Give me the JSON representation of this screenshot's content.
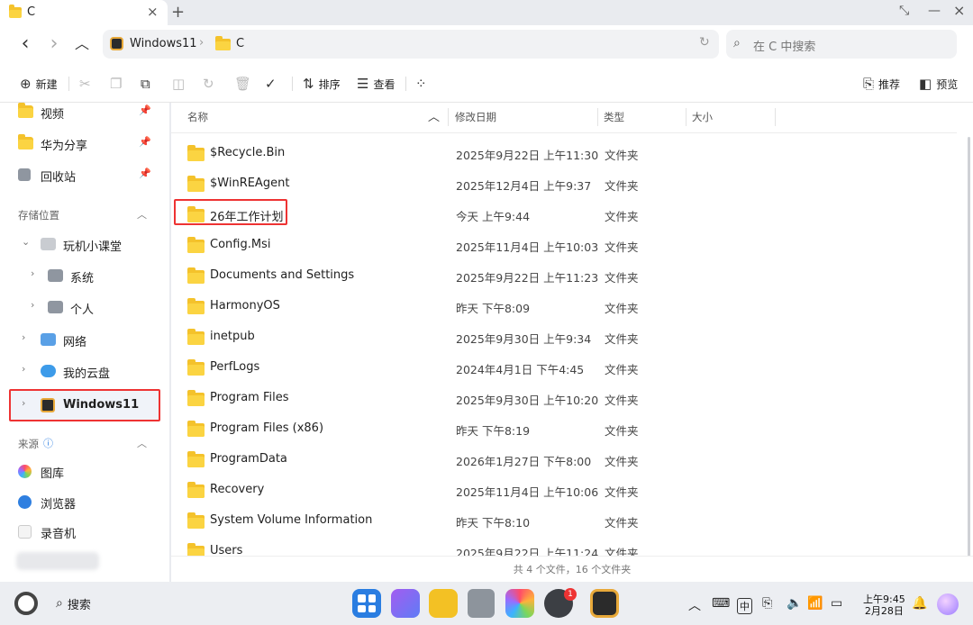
{
  "tab": {
    "title": "C",
    "close": "×",
    "new_tab": "+"
  },
  "window_controls": {
    "collapse": "⤡",
    "minimize": "—",
    "close": "×"
  },
  "nav": {
    "back": "‹",
    "forward": "›",
    "up": "︿"
  },
  "address": {
    "root": "Windows11",
    "separator": "›",
    "current": "C",
    "refresh": "↻"
  },
  "search": {
    "placeholder": "在 C 中搜索",
    "icon": "⌕"
  },
  "toolbar": {
    "new": "新建",
    "sort": "排序",
    "view": "查看",
    "recommend": "推荐",
    "preview": "预览"
  },
  "sidebar": {
    "quick": [
      {
        "label": "视频",
        "pinned": true
      },
      {
        "label": "华为分享",
        "pinned": true
      },
      {
        "label": "回收站",
        "pinned": true
      }
    ],
    "storage_header": "存储位置",
    "storage": [
      {
        "label": "玩机小课堂",
        "expanded": true
      },
      {
        "label": "系统"
      },
      {
        "label": "个人"
      },
      {
        "label": "网络"
      },
      {
        "label": "我的云盘"
      },
      {
        "label": "Windows11",
        "selected": true
      }
    ],
    "source_header": "来源",
    "sources": [
      {
        "label": "图库"
      },
      {
        "label": "浏览器"
      },
      {
        "label": "录音机"
      }
    ]
  },
  "columns": {
    "name": "名称",
    "modified": "修改日期",
    "type": "类型",
    "size": "大小"
  },
  "files": [
    {
      "name": "$Recycle.Bin",
      "modified": "2025年9月22日 上午11:30",
      "type": "文件夹"
    },
    {
      "name": "$WinREAgent",
      "modified": "2025年12月4日 上午9:37",
      "type": "文件夹"
    },
    {
      "name": "26年工作计划",
      "modified": "今天 上午9:44",
      "type": "文件夹",
      "highlighted": true
    },
    {
      "name": "Config.Msi",
      "modified": "2025年11月4日 上午10:03",
      "type": "文件夹"
    },
    {
      "name": "Documents and Settings",
      "modified": "2025年9月22日 上午11:23",
      "type": "文件夹"
    },
    {
      "name": "HarmonyOS",
      "modified": "昨天 下午8:09",
      "type": "文件夹"
    },
    {
      "name": "inetpub",
      "modified": "2025年9月30日 上午9:34",
      "type": "文件夹"
    },
    {
      "name": "PerfLogs",
      "modified": "2024年4月1日 下午4:45",
      "type": "文件夹"
    },
    {
      "name": "Program Files",
      "modified": "2025年9月30日 上午10:20",
      "type": "文件夹"
    },
    {
      "name": "Program Files (x86)",
      "modified": "昨天 下午8:19",
      "type": "文件夹"
    },
    {
      "name": "ProgramData",
      "modified": "2026年1月27日 下午8:00",
      "type": "文件夹"
    },
    {
      "name": "Recovery",
      "modified": "2025年11月4日 上午10:06",
      "type": "文件夹"
    },
    {
      "name": "System Volume Information",
      "modified": "昨天 下午8:10",
      "type": "文件夹"
    },
    {
      "name": "Users",
      "modified": "2025年9月22日 上午11:24",
      "type": "文件夹"
    }
  ],
  "status": "共 4 个文件，16 个文件夹",
  "taskbar": {
    "search": "搜索",
    "notification_badge": "1",
    "ime": "中",
    "time": "上午9:45",
    "date": "2月28日"
  }
}
